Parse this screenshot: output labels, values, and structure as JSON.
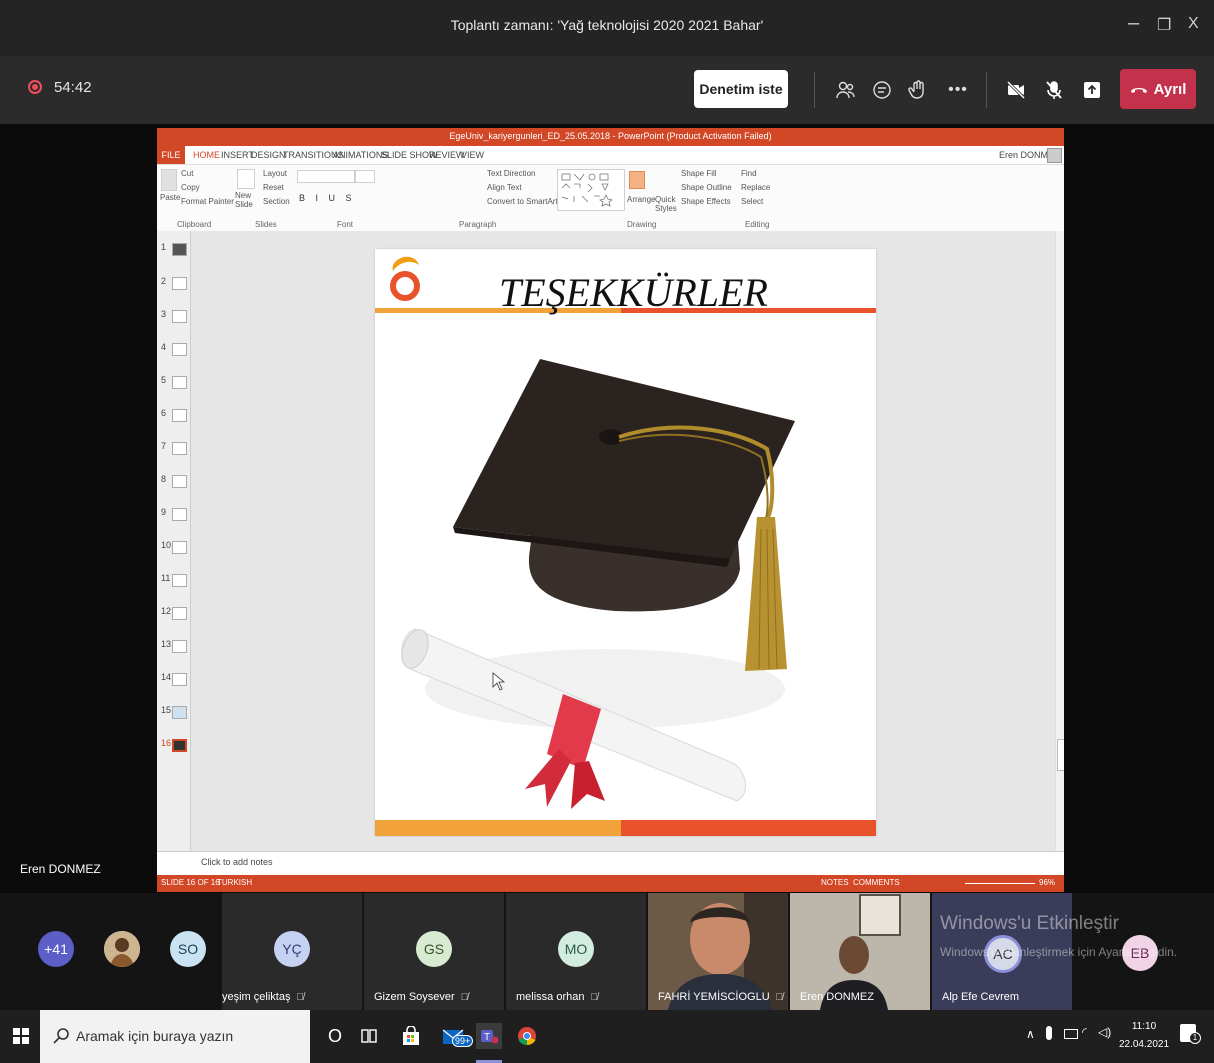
{
  "window": {
    "title": "Toplantı zamanı: 'Yağ teknolojisi 2020 2021 Bahar'",
    "controls": {
      "minimize": "–",
      "restore": "❐",
      "close": "X"
    }
  },
  "meeting": {
    "timer": "54:42",
    "request_control_label": "Denetim iste",
    "leave_label": "Ayrıl",
    "presenter_name": "Eren DONMEZ"
  },
  "powerpoint": {
    "title": "EgeUniv_kariyergunleri_ED_25.05.2018 - PowerPoint (Product Activation Failed)",
    "tabs": [
      "FILE",
      "HOME",
      "INSERT",
      "DESIGN",
      "TRANSITIONS",
      "ANIMATIONS",
      "SLIDE SHOW",
      "REVIEW",
      "VIEW"
    ],
    "user": "Eren DONMEZ",
    "ribbon": {
      "cut": "Cut",
      "copy": "Copy",
      "paste": "Paste",
      "format_painter": "Format Painter",
      "new_slide": "New Slide",
      "layout": "Layout",
      "reset": "Reset",
      "section": "Section",
      "text_direction": "Text Direction",
      "align_text": "Align Text",
      "convert_smartart": "Convert to SmartArt",
      "arrange": "Arrange",
      "quick_styles": "Quick Styles",
      "shape_fill": "Shape Fill",
      "shape_outline": "Shape Outline",
      "shape_effects": "Shape Effects",
      "find": "Find",
      "replace": "Replace",
      "select": "Select",
      "groups": [
        "Clipboard",
        "Slides",
        "Font",
        "Paragraph",
        "Drawing",
        "Editing"
      ]
    },
    "thumbnails": [
      "1",
      "2",
      "3",
      "4",
      "5",
      "6",
      "7",
      "8",
      "9",
      "10",
      "11",
      "12",
      "13",
      "14",
      "15",
      "16"
    ],
    "slide_title": "TEŞEKKÜRLER",
    "notes_placeholder": "Click to add notes",
    "status_slide": "SLIDE 16 OF 16",
    "status_lang": "TURKISH",
    "status_notes": "NOTES",
    "status_comments": "COMMENTS",
    "zoom": "96%"
  },
  "participants": {
    "overflow_count": "+41",
    "tiles": [
      {
        "initials": "SO",
        "name": ""
      },
      {
        "initials": "YÇ",
        "name": "yeşim çeliktaş"
      },
      {
        "initials": "GS",
        "name": "Gizem Soysever"
      },
      {
        "initials": "MO",
        "name": "melissa orhan"
      },
      {
        "initials": "",
        "name": "FAHRİ YEMİSCİOGLU"
      },
      {
        "initials": "",
        "name": "Eren DONMEZ"
      },
      {
        "initials": "AC",
        "name": "Alp Efe Cevrem"
      },
      {
        "initials": "EB",
        "name": ""
      }
    ],
    "watermark_title": "Windows'u Etkinleştir",
    "watermark_sub": "Windows'u etkinleştirmek için Ayarlar'a gidin."
  },
  "taskbar": {
    "search_placeholder": "Aramak için buraya yazın",
    "mail_badge": "99+",
    "time": "11:10",
    "date": "22.04.2021",
    "notif_count": "1"
  }
}
